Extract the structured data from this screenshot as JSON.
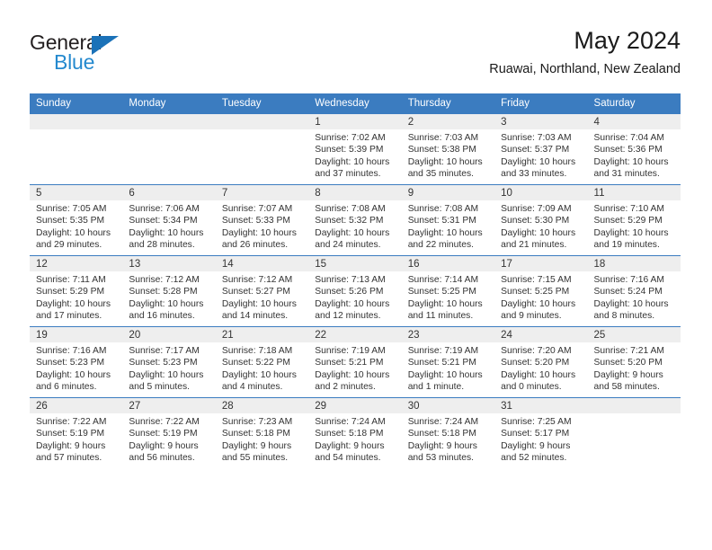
{
  "brand": {
    "name_part1": "General",
    "name_part2": "Blue",
    "triangle_color": "#1b72b8",
    "text_color": "#231f20",
    "blue_color": "#2489ce"
  },
  "header": {
    "title": "May 2024",
    "subtitle": "Ruawai, Northland, New Zealand"
  },
  "colors": {
    "header_blue": "#3b7cc0",
    "daynum_band": "#eeeeee",
    "cell_background": "#ffffff",
    "text": "#333333"
  },
  "weekday_headers": [
    "Sunday",
    "Monday",
    "Tuesday",
    "Wednesday",
    "Thursday",
    "Friday",
    "Saturday"
  ],
  "labels": {
    "sunrise_prefix": "Sunrise:",
    "sunset_prefix": "Sunset:",
    "daylight_prefix": "Daylight:"
  },
  "weeks": [
    [
      {
        "day": "",
        "sunrise": "",
        "sunset": "",
        "daylight_line1": "",
        "daylight_line2": ""
      },
      {
        "day": "",
        "sunrise": "",
        "sunset": "",
        "daylight_line1": "",
        "daylight_line2": ""
      },
      {
        "day": "",
        "sunrise": "",
        "sunset": "",
        "daylight_line1": "",
        "daylight_line2": ""
      },
      {
        "day": "1",
        "sunrise": "Sunrise: 7:02 AM",
        "sunset": "Sunset: 5:39 PM",
        "daylight_line1": "Daylight: 10 hours",
        "daylight_line2": "and 37 minutes."
      },
      {
        "day": "2",
        "sunrise": "Sunrise: 7:03 AM",
        "sunset": "Sunset: 5:38 PM",
        "daylight_line1": "Daylight: 10 hours",
        "daylight_line2": "and 35 minutes."
      },
      {
        "day": "3",
        "sunrise": "Sunrise: 7:03 AM",
        "sunset": "Sunset: 5:37 PM",
        "daylight_line1": "Daylight: 10 hours",
        "daylight_line2": "and 33 minutes."
      },
      {
        "day": "4",
        "sunrise": "Sunrise: 7:04 AM",
        "sunset": "Sunset: 5:36 PM",
        "daylight_line1": "Daylight: 10 hours",
        "daylight_line2": "and 31 minutes."
      }
    ],
    [
      {
        "day": "5",
        "sunrise": "Sunrise: 7:05 AM",
        "sunset": "Sunset: 5:35 PM",
        "daylight_line1": "Daylight: 10 hours",
        "daylight_line2": "and 29 minutes."
      },
      {
        "day": "6",
        "sunrise": "Sunrise: 7:06 AM",
        "sunset": "Sunset: 5:34 PM",
        "daylight_line1": "Daylight: 10 hours",
        "daylight_line2": "and 28 minutes."
      },
      {
        "day": "7",
        "sunrise": "Sunrise: 7:07 AM",
        "sunset": "Sunset: 5:33 PM",
        "daylight_line1": "Daylight: 10 hours",
        "daylight_line2": "and 26 minutes."
      },
      {
        "day": "8",
        "sunrise": "Sunrise: 7:08 AM",
        "sunset": "Sunset: 5:32 PM",
        "daylight_line1": "Daylight: 10 hours",
        "daylight_line2": "and 24 minutes."
      },
      {
        "day": "9",
        "sunrise": "Sunrise: 7:08 AM",
        "sunset": "Sunset: 5:31 PM",
        "daylight_line1": "Daylight: 10 hours",
        "daylight_line2": "and 22 minutes."
      },
      {
        "day": "10",
        "sunrise": "Sunrise: 7:09 AM",
        "sunset": "Sunset: 5:30 PM",
        "daylight_line1": "Daylight: 10 hours",
        "daylight_line2": "and 21 minutes."
      },
      {
        "day": "11",
        "sunrise": "Sunrise: 7:10 AM",
        "sunset": "Sunset: 5:29 PM",
        "daylight_line1": "Daylight: 10 hours",
        "daylight_line2": "and 19 minutes."
      }
    ],
    [
      {
        "day": "12",
        "sunrise": "Sunrise: 7:11 AM",
        "sunset": "Sunset: 5:29 PM",
        "daylight_line1": "Daylight: 10 hours",
        "daylight_line2": "and 17 minutes."
      },
      {
        "day": "13",
        "sunrise": "Sunrise: 7:12 AM",
        "sunset": "Sunset: 5:28 PM",
        "daylight_line1": "Daylight: 10 hours",
        "daylight_line2": "and 16 minutes."
      },
      {
        "day": "14",
        "sunrise": "Sunrise: 7:12 AM",
        "sunset": "Sunset: 5:27 PM",
        "daylight_line1": "Daylight: 10 hours",
        "daylight_line2": "and 14 minutes."
      },
      {
        "day": "15",
        "sunrise": "Sunrise: 7:13 AM",
        "sunset": "Sunset: 5:26 PM",
        "daylight_line1": "Daylight: 10 hours",
        "daylight_line2": "and 12 minutes."
      },
      {
        "day": "16",
        "sunrise": "Sunrise: 7:14 AM",
        "sunset": "Sunset: 5:25 PM",
        "daylight_line1": "Daylight: 10 hours",
        "daylight_line2": "and 11 minutes."
      },
      {
        "day": "17",
        "sunrise": "Sunrise: 7:15 AM",
        "sunset": "Sunset: 5:25 PM",
        "daylight_line1": "Daylight: 10 hours",
        "daylight_line2": "and 9 minutes."
      },
      {
        "day": "18",
        "sunrise": "Sunrise: 7:16 AM",
        "sunset": "Sunset: 5:24 PM",
        "daylight_line1": "Daylight: 10 hours",
        "daylight_line2": "and 8 minutes."
      }
    ],
    [
      {
        "day": "19",
        "sunrise": "Sunrise: 7:16 AM",
        "sunset": "Sunset: 5:23 PM",
        "daylight_line1": "Daylight: 10 hours",
        "daylight_line2": "and 6 minutes."
      },
      {
        "day": "20",
        "sunrise": "Sunrise: 7:17 AM",
        "sunset": "Sunset: 5:23 PM",
        "daylight_line1": "Daylight: 10 hours",
        "daylight_line2": "and 5 minutes."
      },
      {
        "day": "21",
        "sunrise": "Sunrise: 7:18 AM",
        "sunset": "Sunset: 5:22 PM",
        "daylight_line1": "Daylight: 10 hours",
        "daylight_line2": "and 4 minutes."
      },
      {
        "day": "22",
        "sunrise": "Sunrise: 7:19 AM",
        "sunset": "Sunset: 5:21 PM",
        "daylight_line1": "Daylight: 10 hours",
        "daylight_line2": "and 2 minutes."
      },
      {
        "day": "23",
        "sunrise": "Sunrise: 7:19 AM",
        "sunset": "Sunset: 5:21 PM",
        "daylight_line1": "Daylight: 10 hours",
        "daylight_line2": "and 1 minute."
      },
      {
        "day": "24",
        "sunrise": "Sunrise: 7:20 AM",
        "sunset": "Sunset: 5:20 PM",
        "daylight_line1": "Daylight: 10 hours",
        "daylight_line2": "and 0 minutes."
      },
      {
        "day": "25",
        "sunrise": "Sunrise: 7:21 AM",
        "sunset": "Sunset: 5:20 PM",
        "daylight_line1": "Daylight: 9 hours",
        "daylight_line2": "and 58 minutes."
      }
    ],
    [
      {
        "day": "26",
        "sunrise": "Sunrise: 7:22 AM",
        "sunset": "Sunset: 5:19 PM",
        "daylight_line1": "Daylight: 9 hours",
        "daylight_line2": "and 57 minutes."
      },
      {
        "day": "27",
        "sunrise": "Sunrise: 7:22 AM",
        "sunset": "Sunset: 5:19 PM",
        "daylight_line1": "Daylight: 9 hours",
        "daylight_line2": "and 56 minutes."
      },
      {
        "day": "28",
        "sunrise": "Sunrise: 7:23 AM",
        "sunset": "Sunset: 5:18 PM",
        "daylight_line1": "Daylight: 9 hours",
        "daylight_line2": "and 55 minutes."
      },
      {
        "day": "29",
        "sunrise": "Sunrise: 7:24 AM",
        "sunset": "Sunset: 5:18 PM",
        "daylight_line1": "Daylight: 9 hours",
        "daylight_line2": "and 54 minutes."
      },
      {
        "day": "30",
        "sunrise": "Sunrise: 7:24 AM",
        "sunset": "Sunset: 5:18 PM",
        "daylight_line1": "Daylight: 9 hours",
        "daylight_line2": "and 53 minutes."
      },
      {
        "day": "31",
        "sunrise": "Sunrise: 7:25 AM",
        "sunset": "Sunset: 5:17 PM",
        "daylight_line1": "Daylight: 9 hours",
        "daylight_line2": "and 52 minutes."
      },
      {
        "day": "",
        "sunrise": "",
        "sunset": "",
        "daylight_line1": "",
        "daylight_line2": ""
      }
    ]
  ]
}
